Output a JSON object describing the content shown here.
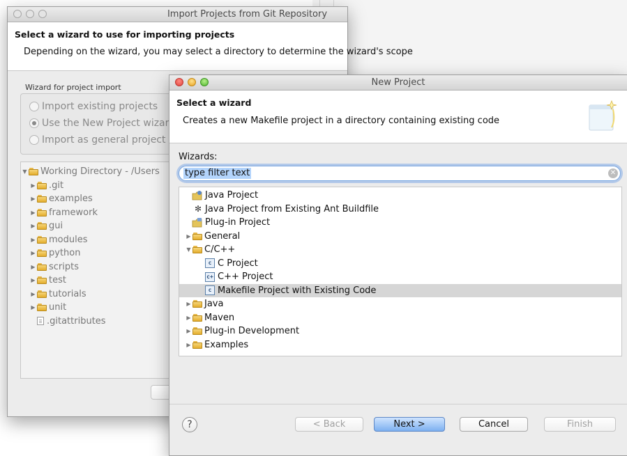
{
  "back_window": {
    "title": "Import Projects from Git Repository /Users/aqw/ICEFiles/moose/.git",
    "heading": "Select a wizard to use for importing projects",
    "description": "Depending on the wizard, you may select a directory to determine the wizard's scope",
    "group_label": "Wizard for project import",
    "options": [
      {
        "label": "Import existing projects",
        "selected": false
      },
      {
        "label": "Use the New Project wizard",
        "selected": true
      },
      {
        "label": "Import as general project",
        "selected": false
      }
    ],
    "tree_root": "Working Directory - /Users",
    "tree_items": [
      ".git",
      "examples",
      "framework",
      "gui",
      "modules",
      "python",
      "scripts",
      "test",
      "tutorials",
      "unit"
    ],
    "tree_file": ".gitattributes"
  },
  "new_project": {
    "title": "New Project",
    "heading": "Select a wizard",
    "description": "Creates a new Makefile project in a directory containing existing code",
    "wizards_label": "Wizards:",
    "filter_text": "type filter text",
    "tree": [
      {
        "label": "Java Project",
        "icon": "java-project-icon"
      },
      {
        "label": "Java Project from Existing Ant Buildfile",
        "icon": "ant-icon"
      },
      {
        "label": "Plug-in Project",
        "icon": "plugin-project-icon"
      },
      {
        "label": "General",
        "icon": "folder-icon"
      },
      {
        "label": "C/C++",
        "icon": "folder-icon"
      },
      {
        "label": "C Project",
        "icon": "c-project-icon"
      },
      {
        "label": "C++ Project",
        "icon": "cpp-project-icon"
      },
      {
        "label": "Makefile Project with Existing Code",
        "icon": "makefile-project-icon",
        "selected": true
      },
      {
        "label": "Java",
        "icon": "folder-icon"
      },
      {
        "label": "Maven",
        "icon": "folder-icon"
      },
      {
        "label": "Plug-in Development",
        "icon": "folder-icon"
      },
      {
        "label": "Examples",
        "icon": "folder-icon"
      }
    ],
    "buttons": {
      "back": "< Back",
      "next": "Next >",
      "cancel": "Cancel",
      "finish": "Finish"
    },
    "help_glyph": "?"
  },
  "colors": {
    "selection": "#d6d6d6",
    "default_button": "#7db0f0"
  }
}
